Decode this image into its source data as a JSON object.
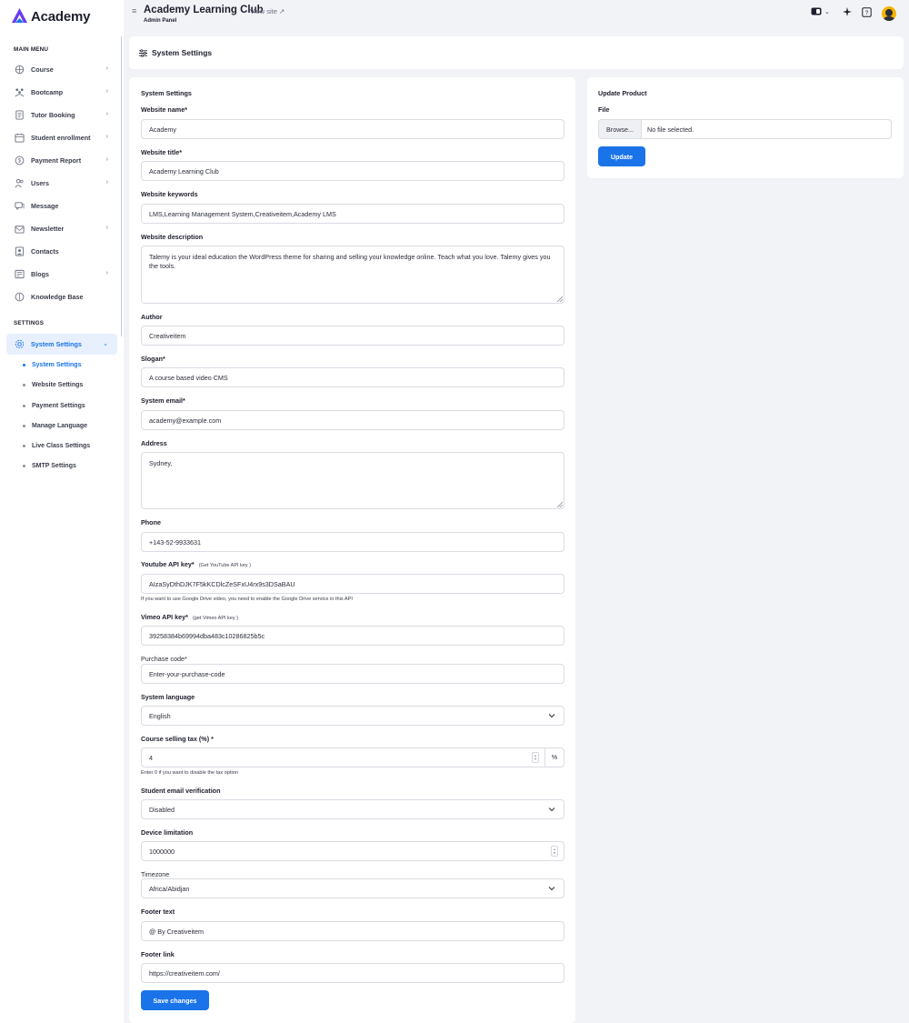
{
  "brand": {
    "name": "Academy",
    "accent": "#1a73e8"
  },
  "topbar": {
    "title": "Academy Learning Club",
    "subtitle": "Admin Panel",
    "view_site": "View site"
  },
  "sidebar": {
    "main_menu_heading": "MAIN MENU",
    "settings_heading": "SETTINGS",
    "items": [
      {
        "label": "Course",
        "icon": "course-icon"
      },
      {
        "label": "Bootcamp",
        "icon": "bootcamp-icon"
      },
      {
        "label": "Tutor Booking",
        "icon": "tutor-booking-icon"
      },
      {
        "label": "Student enrollment",
        "icon": "enrollment-icon"
      },
      {
        "label": "Payment Report",
        "icon": "payment-icon"
      },
      {
        "label": "Users",
        "icon": "users-icon"
      },
      {
        "label": "Message",
        "icon": "message-icon"
      },
      {
        "label": "Newsletter",
        "icon": "newsletter-icon"
      },
      {
        "label": "Contacts",
        "icon": "contacts-icon"
      },
      {
        "label": "Blogs",
        "icon": "blogs-icon"
      },
      {
        "label": "Knowledge Base",
        "icon": "knowledge-base-icon"
      }
    ],
    "settings_item": {
      "label": "System Settings",
      "icon": "gear-icon"
    },
    "sub_items": [
      "System Settings",
      "Website Settings",
      "Payment Settings",
      "Manage Language",
      "Live Class Settings",
      "SMTP Settings"
    ]
  },
  "page": {
    "title": "System Settings"
  },
  "form": {
    "heading": "System Settings",
    "website_name": {
      "label": "Website name*",
      "value": "Academy"
    },
    "website_title": {
      "label": "Website title*",
      "value": "Academy Learning Club"
    },
    "website_keywords": {
      "label": "Website keywords",
      "value": "LMS,Learning Management System,Creativeitem,Academy LMS"
    },
    "website_description": {
      "label": "Website description",
      "value": "Talemy is your ideal education the WordPress theme for sharing and selling your knowledge online. Teach what you love. Talemy gives you the tools."
    },
    "author": {
      "label": "Author",
      "value": "Creativeitem"
    },
    "slogan": {
      "label": "Slogan*",
      "value": "A course based video CMS"
    },
    "system_email": {
      "label": "System email*",
      "value": "academy@example.com"
    },
    "address": {
      "label": "Address",
      "value": "Sydney,"
    },
    "phone": {
      "label": "Phone",
      "value": "+143-52-9933631"
    },
    "youtube_api_key": {
      "label": "Youtube API key*",
      "link": "(Get YouTube API key )",
      "value": "AIzaSyDthDJK7F5kKCDlcZeSFxU4rx9s3DSaBAU",
      "hint": "If you want to use Google Drive video, you need to enable the Google Drive service in this API"
    },
    "vimeo_api_key": {
      "label": "Vimeo API key*",
      "link": "(get Vimeo API key )",
      "value": "39258384b69994dba483c10286825b5c"
    },
    "purchase_code": {
      "label": "Purchase code*",
      "placeholder": "Enter-your-purchase-code"
    },
    "system_language": {
      "label": "System language",
      "value": "English"
    },
    "course_selling_tax": {
      "label": "Course selling tax (%) *",
      "value": "4",
      "addon": "%",
      "hint": "Enter 0 if you want to disable the tax option"
    },
    "student_email_verification": {
      "label": "Student email verification",
      "value": "Disabled"
    },
    "device_limitation": {
      "label": "Device limitation",
      "value": "1000000"
    },
    "timezone": {
      "label": "Timezone",
      "value": "Africa/Abidjan"
    },
    "footer_text": {
      "label": "Footer text",
      "value": "@ By Creativeitem"
    },
    "footer_link": {
      "label": "Footer link",
      "value": "https://creativeitem.com/"
    },
    "save_label": "Save changes"
  },
  "update_product": {
    "heading": "Update Product",
    "file_label": "File",
    "browse_label": "Browse...",
    "file_status": "No file selected.",
    "update_label": "Update"
  }
}
